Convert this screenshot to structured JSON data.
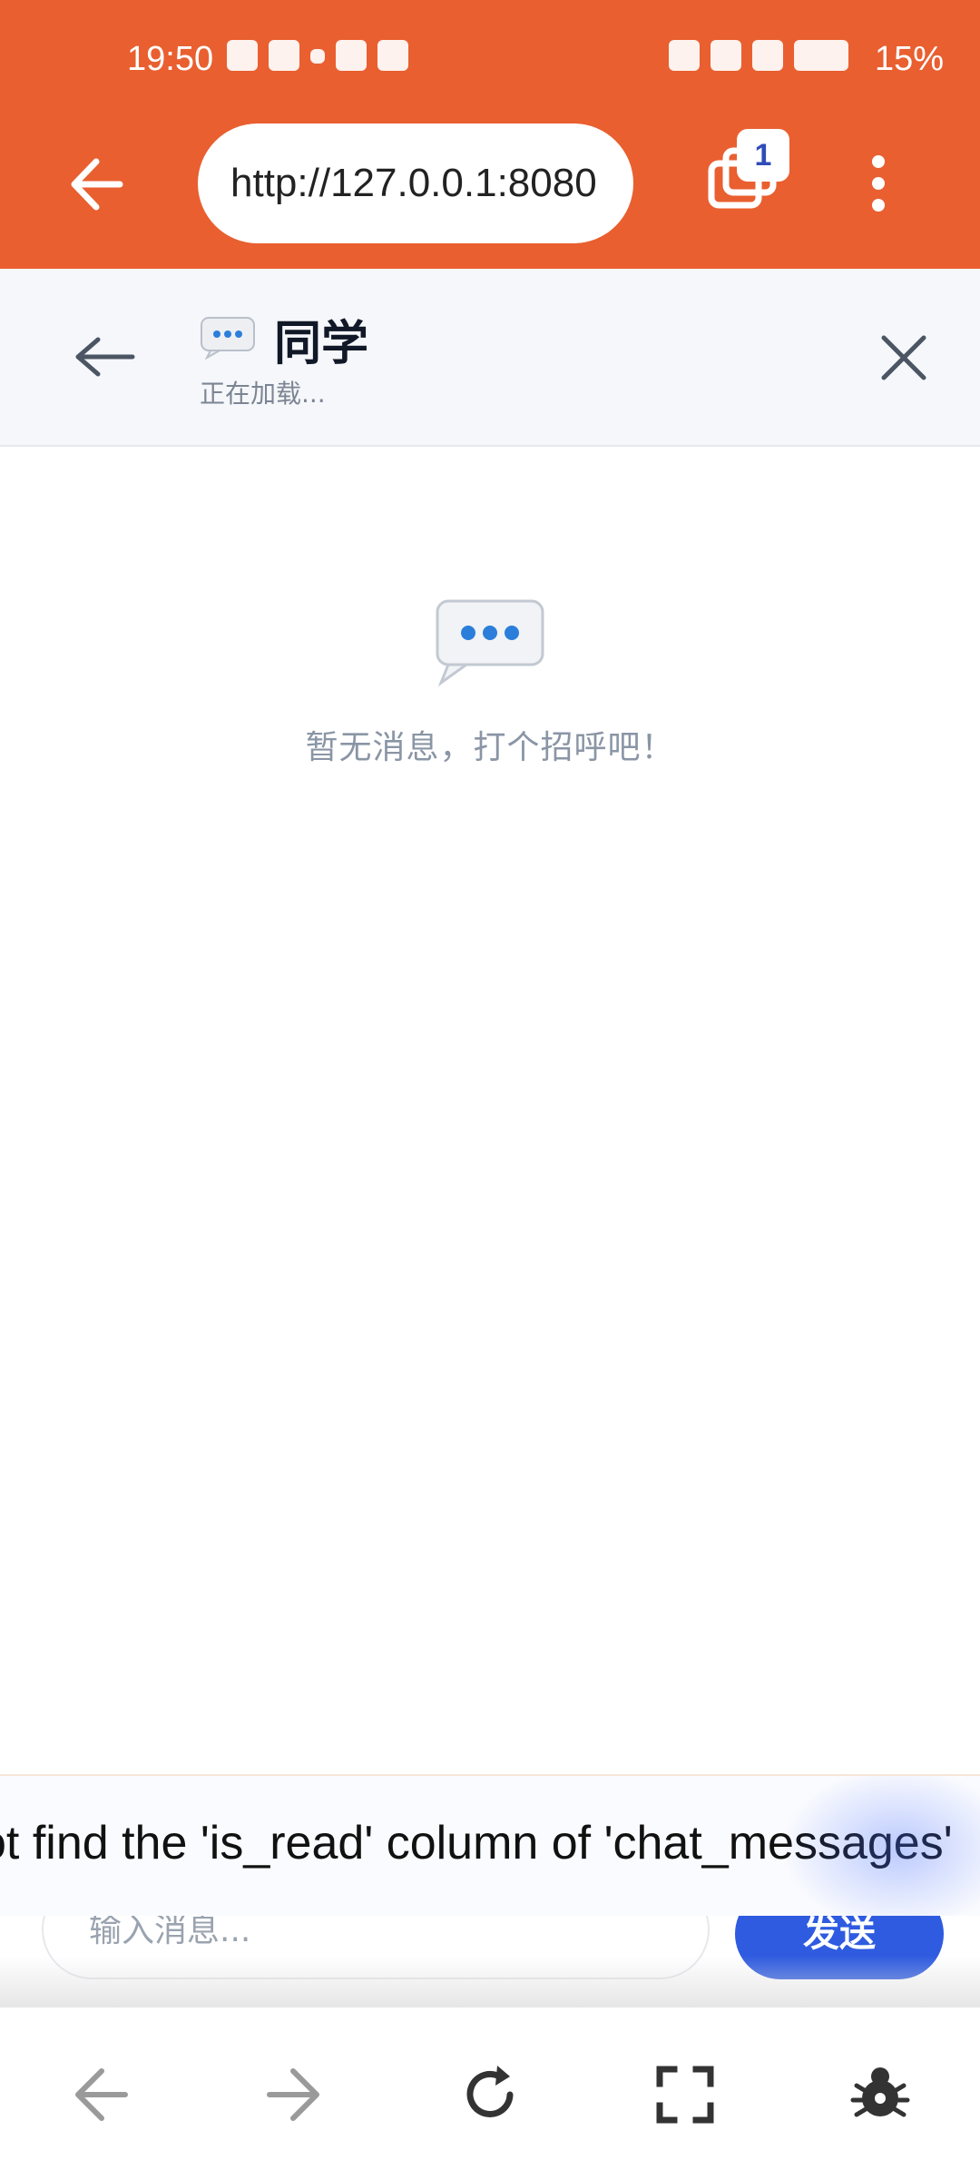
{
  "status_bar": {
    "time": "19:50",
    "battery_text": "15%"
  },
  "browser": {
    "url": "http://127.0.0.1:8080",
    "tab_count": "1"
  },
  "chat": {
    "title": "同学",
    "subtitle": "正在加载...",
    "empty_message": "暂无消息，打个招呼吧！"
  },
  "toast": {
    "text": "ot find the 'is_read' column of 'chat_messages'"
  },
  "composer": {
    "placeholder": "输入消息...",
    "send_label": "发送"
  },
  "colors": {
    "brand_orange": "#E95F30",
    "primary_blue": "#2E5BE0",
    "muted_text": "#8A95A5"
  }
}
